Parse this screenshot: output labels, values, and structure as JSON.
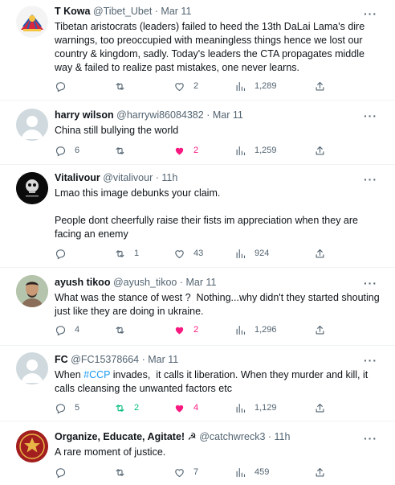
{
  "tweets": [
    {
      "name": "T Kowa",
      "handle": "@Tibet_Ubet",
      "time": "Mar 11",
      "text": "Tibetan aristocrats (leaders) failed to heed the 13th DaLai Lama's dire warnings, too preoccupied with meaningless things hence we lost our country & kingdom, sadly. Today's leaders the CTA propagates middle way & failed to realize past mistakes, one never learns.",
      "replies": "",
      "retweets": "",
      "likes": "2",
      "views": "1,289",
      "liked": false,
      "retweeted": false
    },
    {
      "name": "harry wilson",
      "handle": "@harrywi86084382",
      "time": "Mar 11",
      "text": "China still bullying the world",
      "replies": "6",
      "retweets": "",
      "likes": "2",
      "views": "1,259",
      "liked": true,
      "retweeted": false
    },
    {
      "name": "Vitalivour",
      "handle": "@vitalivour",
      "time": "11h",
      "text": "Lmao this image debunks your claim.\n\nPeople dont cheerfully raise their fists im appreciation when they are facing an enemy",
      "replies": "",
      "retweets": "1",
      "likes": "43",
      "views": "924",
      "liked": false,
      "retweeted": false
    },
    {
      "name": "ayush tikoo",
      "handle": "@ayush_tikoo",
      "time": "Mar 11",
      "text": "What was the stance of west ?  Nothing...why didn't they started shouting just like they are doing in ukraine.",
      "replies": "4",
      "retweets": "",
      "likes": "2",
      "views": "1,296",
      "liked": true,
      "retweeted": false
    },
    {
      "name": "FC",
      "handle": "@FC15378664",
      "time": "Mar 11",
      "text_before": "When ",
      "hashtag": "#CCP",
      "text_after": " invades,  it calls it liberation. When they murder and kill, it calls cleansing the unwanted factors etc",
      "replies": "5",
      "retweets": "2",
      "likes": "4",
      "views": "1,129",
      "liked": true,
      "retweeted": true
    },
    {
      "name": "Organize, Educate, Agitate! ☭",
      "handle": "@catchwreck3",
      "time": "11h",
      "text": "A rare moment of justice.",
      "replies": "",
      "retweets": "",
      "likes": "7",
      "views": "459",
      "liked": false,
      "retweeted": false
    }
  ],
  "separator": " · ",
  "more_glyph": "···",
  "colors": {
    "text": "#0f1419",
    "muted": "#536471",
    "like": "#f91880",
    "retweet": "#00ba7c",
    "link": "#1d9bf0",
    "divider": "#eff3f4"
  }
}
